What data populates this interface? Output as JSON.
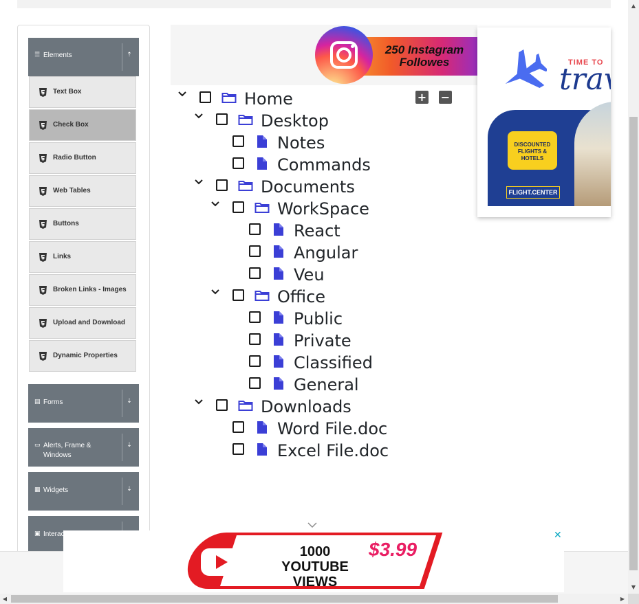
{
  "sidebar": {
    "groups": [
      {
        "label": "Elements",
        "icon": "hamburger-icon"
      },
      {
        "label": "Forms",
        "icon": "form-icon"
      },
      {
        "label": "Alerts, Frame & Windows",
        "icon": "window-icon"
      },
      {
        "label": "Widgets",
        "icon": "grid-icon"
      },
      {
        "label": "Interac",
        "icon": "interactions-icon"
      }
    ],
    "items": [
      {
        "label": "Text Box"
      },
      {
        "label": "Check Box"
      },
      {
        "label": "Radio Button"
      },
      {
        "label": "Web Tables"
      },
      {
        "label": "Buttons"
      },
      {
        "label": "Links"
      },
      {
        "label": "Broken Links - Images"
      },
      {
        "label": "Upload and Download"
      },
      {
        "label": "Dynamic Properties"
      }
    ],
    "active_item": "Check Box"
  },
  "tree": {
    "nodes": [
      {
        "label": "Home",
        "type": "folder",
        "expanded": true,
        "checked": false
      },
      {
        "label": "Desktop",
        "type": "folder",
        "expanded": true,
        "checked": false
      },
      {
        "label": "Notes",
        "type": "file",
        "checked": false
      },
      {
        "label": "Commands",
        "type": "file",
        "checked": false
      },
      {
        "label": "Documents",
        "type": "folder",
        "expanded": true,
        "checked": false
      },
      {
        "label": "WorkSpace",
        "type": "folder",
        "expanded": true,
        "checked": false
      },
      {
        "label": "React",
        "type": "file",
        "checked": false
      },
      {
        "label": "Angular",
        "type": "file",
        "checked": false
      },
      {
        "label": "Veu",
        "type": "file",
        "checked": false
      },
      {
        "label": "Office",
        "type": "folder",
        "expanded": true,
        "checked": false
      },
      {
        "label": "Public",
        "type": "file",
        "checked": false
      },
      {
        "label": "Private",
        "type": "file",
        "checked": false
      },
      {
        "label": "Classified",
        "type": "file",
        "checked": false
      },
      {
        "label": "General",
        "type": "file",
        "checked": false
      },
      {
        "label": "Downloads",
        "type": "folder",
        "expanded": true,
        "checked": false
      },
      {
        "label": "Word File.doc",
        "type": "file",
        "checked": false
      },
      {
        "label": "Excel File.doc",
        "type": "file",
        "checked": false
      }
    ],
    "actions": {
      "expand_all": "+",
      "collapse_all": "−"
    }
  },
  "ads": {
    "instagram": {
      "text_line1": "250 Instagram",
      "text_line2": "Followes"
    },
    "travel": {
      "line1": "TIME TO",
      "line2": "travel",
      "badge": "DISCOUNTED FLIGHTS & HOTELS",
      "brand": "FLIGHT.CENTER"
    },
    "youtube": {
      "text_line1": "1000",
      "text_line2": "YOUTUBE VIEWS",
      "price": "$3.99"
    },
    "close_glyph": "✕"
  },
  "colors": {
    "accent_folder": "#3b3fd6",
    "sidebar_header": "#6c757d",
    "sidebar_item": "#e9e9e9",
    "sidebar_item_active": "#b8b8b8"
  }
}
